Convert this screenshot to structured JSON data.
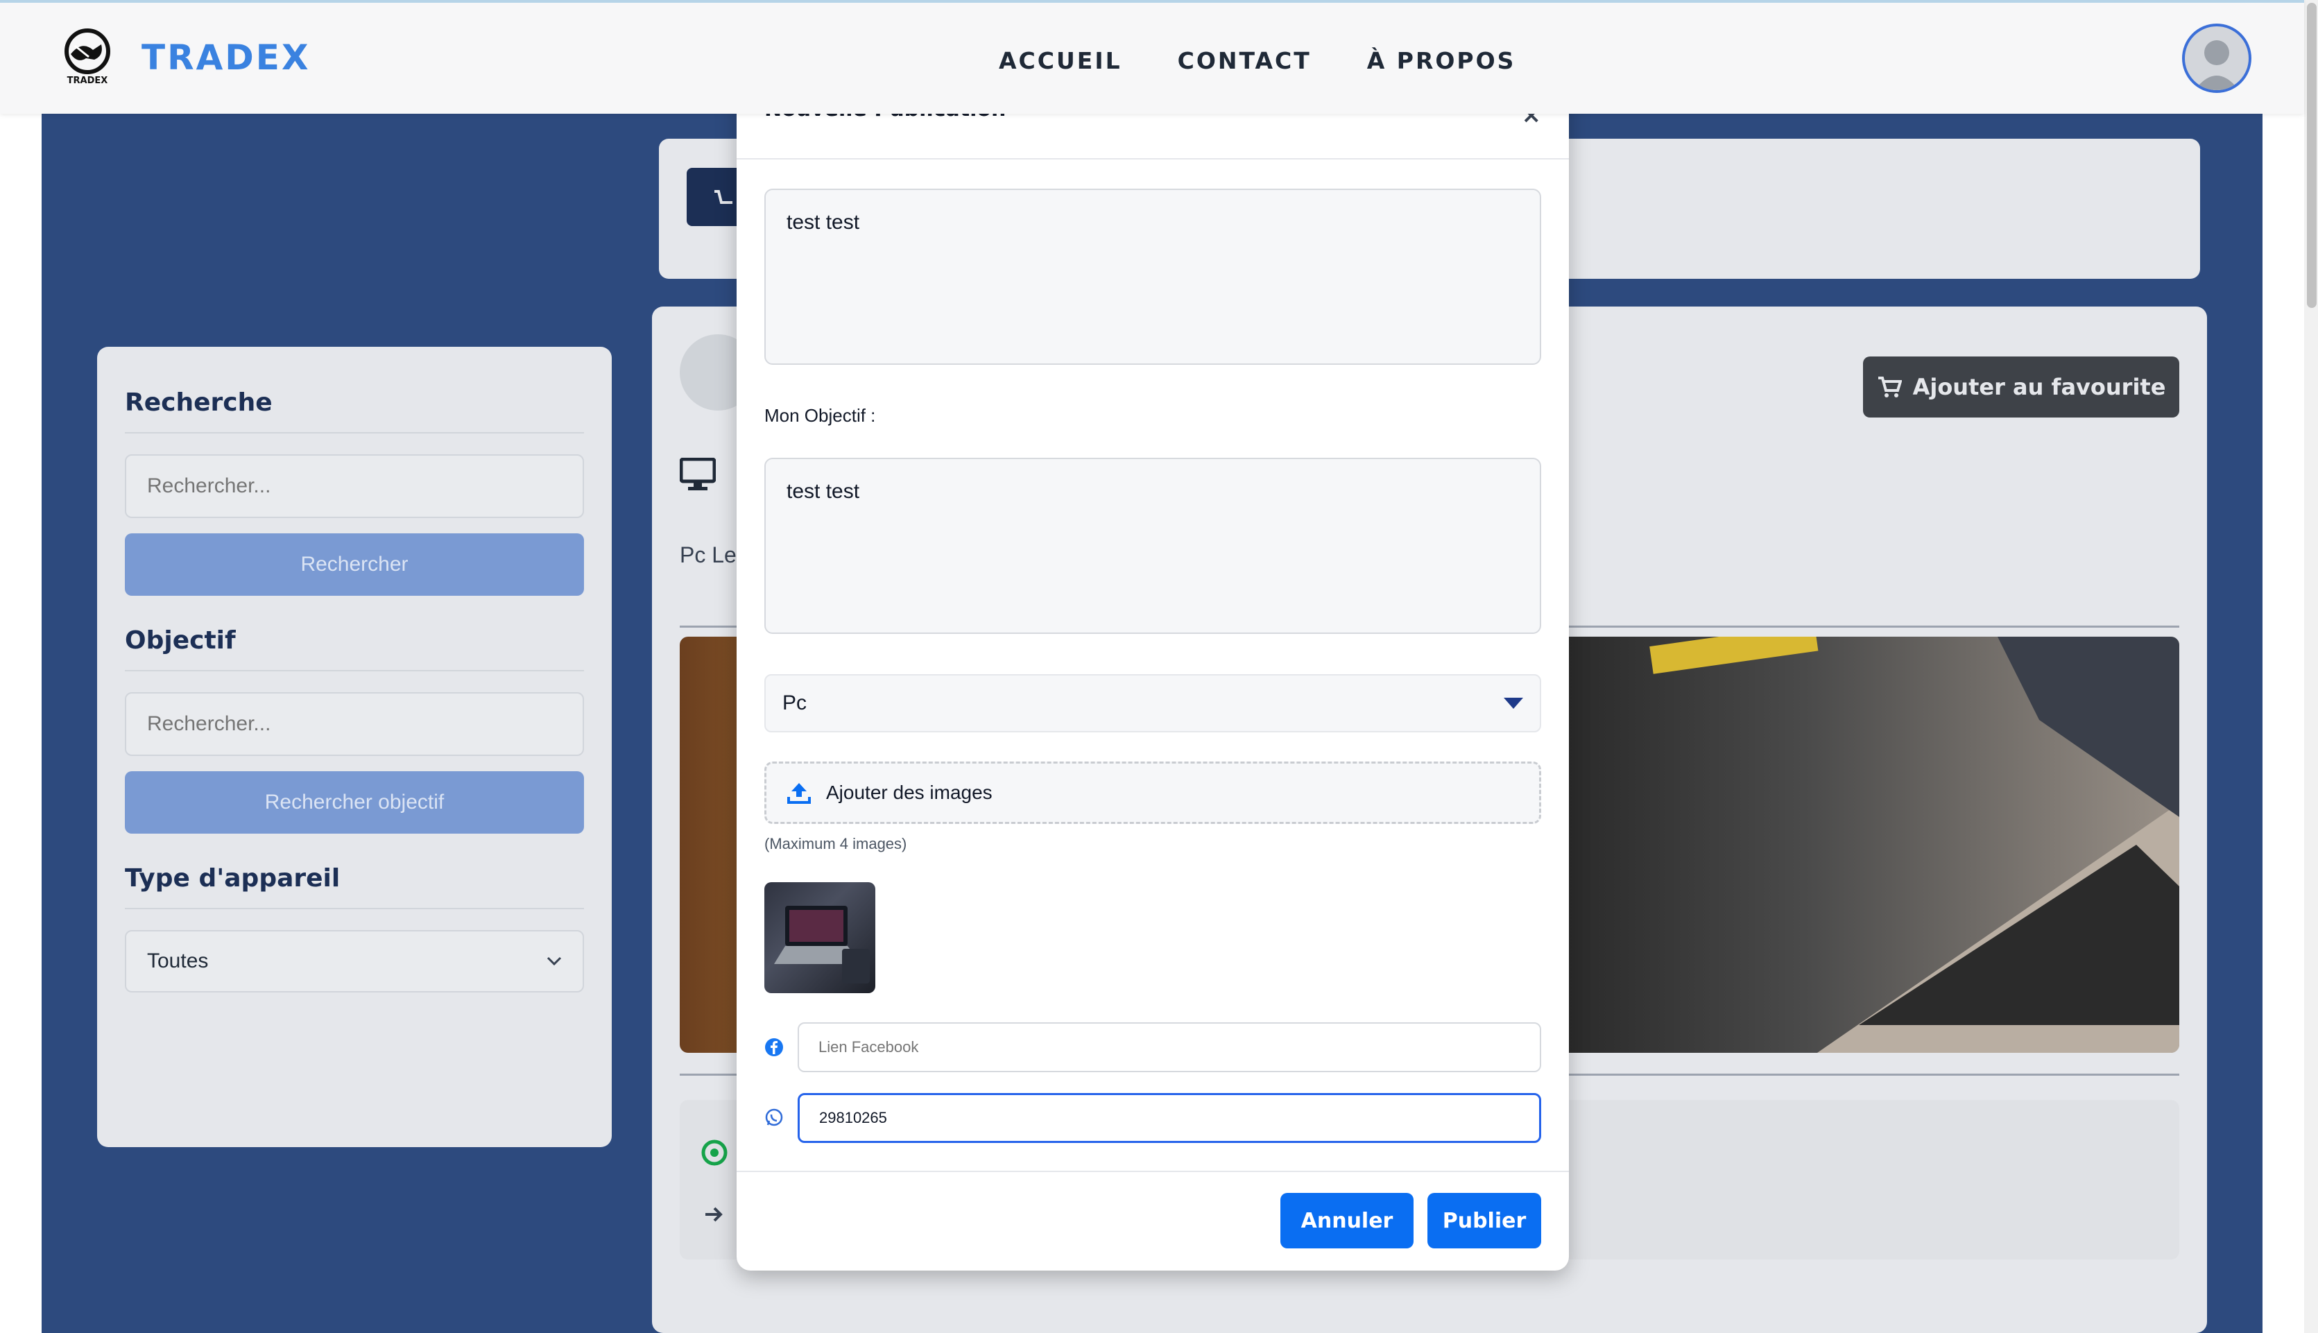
{
  "header": {
    "logo_text": "TRADEX",
    "logo_small": "TRADEX",
    "nav": [
      "ACCUEIL",
      "CONTACT",
      "À PROPOS"
    ]
  },
  "sidebar": {
    "search_title": "Recherche",
    "search_placeholder": "Rechercher...",
    "search_button": "Rechercher",
    "objective_title": "Objectif",
    "objective_placeholder": "Rechercher...",
    "objective_button": "Rechercher objectif",
    "device_title": "Type d'appareil",
    "device_selected": "Toutes"
  },
  "post": {
    "fav_button": "Ajouter au favourite",
    "text_partial": "Pc Le"
  },
  "modal": {
    "title": "Nouvelle Publication",
    "close": "×",
    "description_value": "test test",
    "objective_label": "Mon Objectif :",
    "objective_value": "test test",
    "device_selected": "Pc",
    "upload_label": "Ajouter des images",
    "upload_hint": "(Maximum 4 images)",
    "facebook_placeholder": "Lien Facebook",
    "whatsapp_value": "29810265",
    "cancel_button": "Annuler",
    "publish_button": "Publier"
  },
  "colors": {
    "brand_blue": "#3a82e0",
    "page_navy": "#2d4a7e",
    "primary_button": "#0a6ef2",
    "facebook": "#1877f2",
    "whatsapp": "#2f6bd8"
  }
}
